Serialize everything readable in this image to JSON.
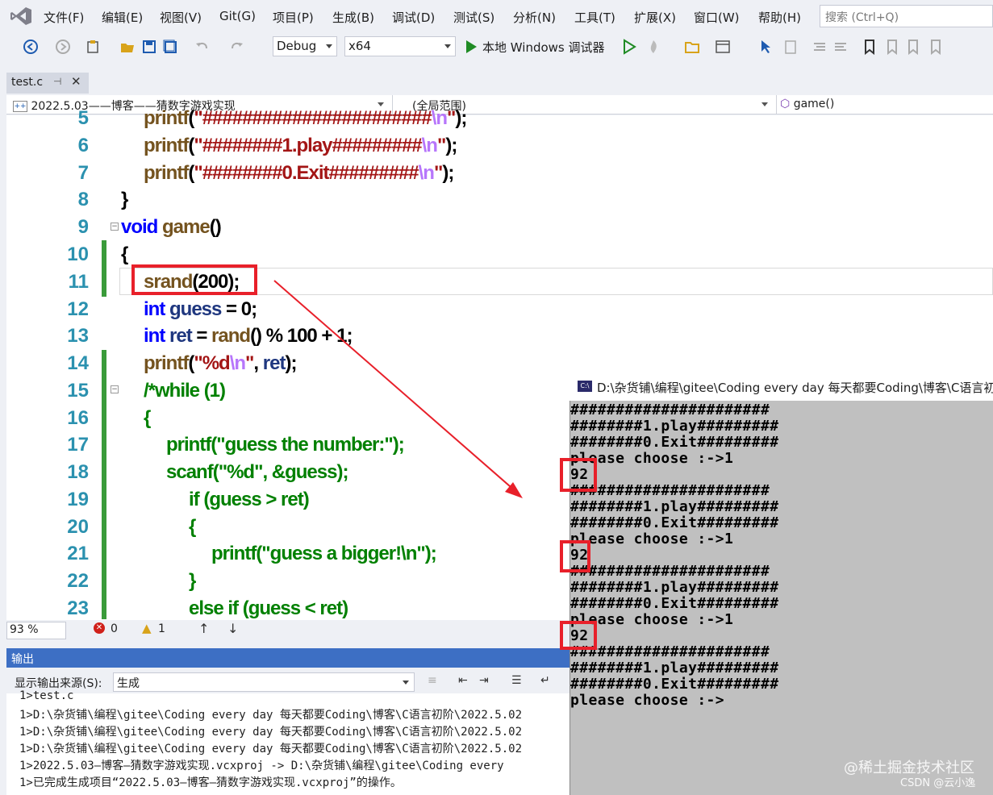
{
  "menu": {
    "items": [
      "文件(F)",
      "编辑(E)",
      "视图(V)",
      "Git(G)",
      "项目(P)",
      "生成(B)",
      "调试(D)",
      "测试(S)",
      "分析(N)",
      "工具(T)",
      "扩展(X)",
      "窗口(W)",
      "帮助(H)"
    ],
    "search_placeholder": "搜索 (Ctrl+Q)"
  },
  "toolbar": {
    "config": "Debug",
    "platform": "x64",
    "run_label": "本地 Windows 调试器"
  },
  "tabs": [
    {
      "label": "test.c"
    }
  ],
  "navbar": {
    "project": "2022.5.03——博客——猜数字游戏实现",
    "scope": "(全局范围)",
    "member": "game()"
  },
  "editor": {
    "line_numbers": [
      "5",
      "6",
      "7",
      "8",
      "9",
      "10",
      "11",
      "12",
      "13",
      "14",
      "15",
      "16",
      "17",
      "18",
      "19",
      "20",
      "21",
      "22",
      "23"
    ]
  },
  "status": {
    "zoom": "93 %",
    "errors": "0",
    "warnings": "1"
  },
  "output": {
    "header": "输出",
    "source_label": "显示输出来源(S):",
    "source_value": "生成",
    "lines": [
      "1>test.c",
      "1>D:\\杂货铺\\编程\\gitee\\Coding every day 每天都要Coding\\博客\\C语言初阶\\2022.5.02",
      "1>D:\\杂货铺\\编程\\gitee\\Coding every day 每天都要Coding\\博客\\C语言初阶\\2022.5.02",
      "1>D:\\杂货铺\\编程\\gitee\\Coding every day 每天都要Coding\\博客\\C语言初阶\\2022.5.02",
      "1>2022.5.03—博客—猜数字游戏实现.vcxproj -> D:\\杂货铺\\编程\\gitee\\Coding every",
      "1>已完成生成项目“2022.5.03—博客—猜数字游戏实现.vcxproj”的操作。"
    ]
  },
  "console": {
    "title": "D:\\杂货铺\\编程\\gitee\\Coding every day 每天都要Coding\\博客\\C语言初",
    "lines": [
      "######################",
      "########1.play#########",
      "########0.Exit#########",
      "please choose :->1",
      "92",
      "######################",
      "########1.play#########",
      "########0.Exit#########",
      "please choose :->1",
      "92",
      "######################",
      "########1.play#########",
      "########0.Exit#########",
      "please choose :->1",
      "92",
      "######################",
      "########1.play#########",
      "########0.Exit#########",
      "please choose :->"
    ]
  },
  "watermark": {
    "line1": "@稀土掘金技术社区",
    "line2": "CSDN @云小逸"
  }
}
